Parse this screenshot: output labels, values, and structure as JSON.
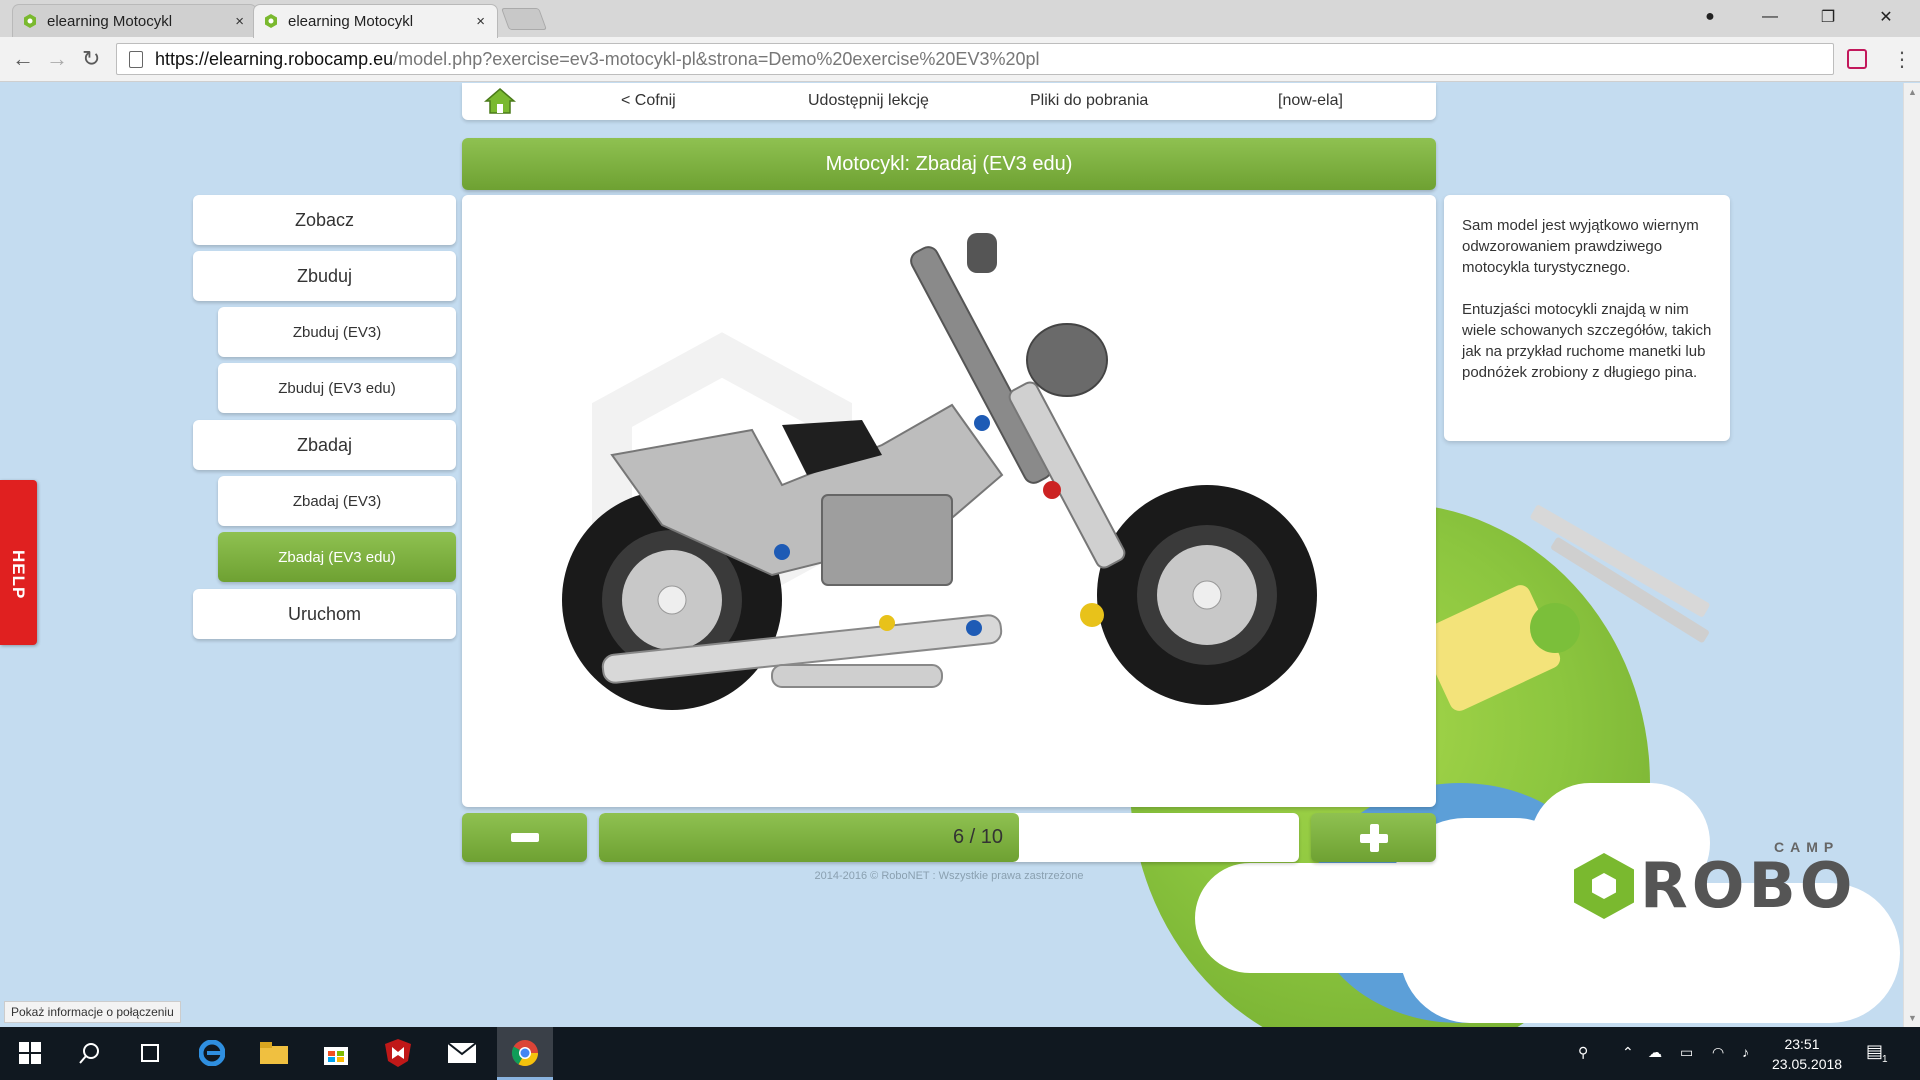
{
  "browser": {
    "tabs": [
      {
        "label": "elearning Motocykl",
        "close": "×"
      },
      {
        "label": "elearning Motocykl",
        "close": "×"
      }
    ],
    "window_controls": {
      "user": "●",
      "minimize": "—",
      "maximize": "❐",
      "close": "✕"
    },
    "url_host": "https://elearning.robocamp.eu",
    "url_rest": "/model.php?exercise=ev3-motocykl-pl&strona=Demo%20exercise%20EV3%20pl",
    "nav": {
      "back": "←",
      "forward": "→",
      "reload": "↻"
    },
    "menu": "⋮"
  },
  "topnav": {
    "back": "< Cofnij",
    "share": "Udostępnij lekcję",
    "downloads": "Pliki do pobrania",
    "user": "[now-ela]"
  },
  "title": "Motocykl: Zbadaj (EV3 edu)",
  "sidebar": {
    "items": [
      {
        "label": "Zobacz"
      },
      {
        "label": "Zbuduj"
      },
      {
        "label": "Zbuduj (EV3)"
      },
      {
        "label": "Zbuduj (EV3 edu)"
      },
      {
        "label": "Zbadaj"
      },
      {
        "label": "Zbadaj (EV3)"
      },
      {
        "label": "Zbadaj (EV3 edu)"
      },
      {
        "label": "Uruchom"
      }
    ]
  },
  "description": {
    "p1": "Sam model jest wyjątkowo wiernym odwzorowaniem prawdziwego motocykla turystycznego.",
    "p2": "Entuzjaści motocykli znajdą w nim wiele schowanych szczegółów, takich jak na przykład ruchome manetki lub podnóżek zrobiony z długiego pina."
  },
  "stepper": {
    "current": 6,
    "total": 10,
    "label": "6 / 10"
  },
  "footer": "2014-2016 © RoboNET : Wszystkie prawa zastrzeżone",
  "help": "HELP",
  "logo": {
    "word": "ROBO",
    "camp": "CAMP"
  },
  "status_tip": "Pokaż informacje o połączeniu",
  "taskbar": {
    "clock_time": "23:51",
    "clock_date": "23.05.2018",
    "notif_count": "1"
  },
  "colors": {
    "accent_green": "#7ab92f",
    "help_red": "#e02020",
    "sky": "#c4dcf0"
  }
}
